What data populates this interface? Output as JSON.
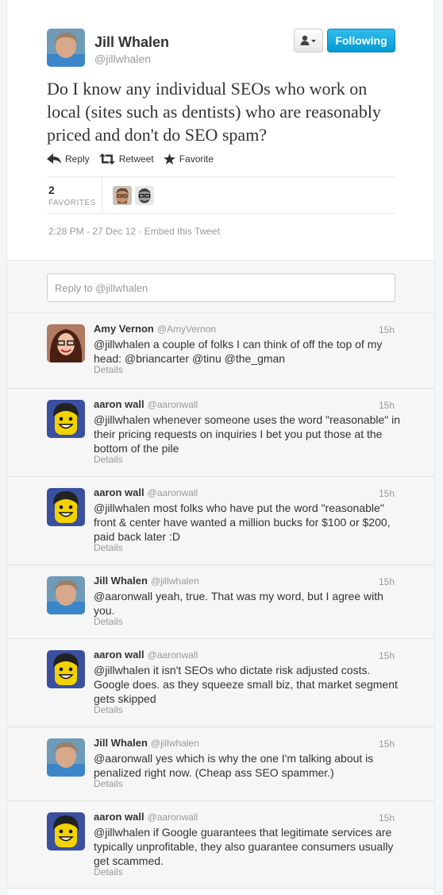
{
  "tweet": {
    "author_name": "Jill Whalen",
    "author_handle": "@jillwhalen",
    "text": "Do I know any individual SEOs who work on local (sites such as dentists) who are reasonably priced and don't do SEO spam?",
    "follow_label": "Following",
    "actions": {
      "reply": "Reply",
      "retweet": "Retweet",
      "favorite": "Favorite"
    },
    "favorites_count": "2",
    "favorites_label": "FAVORITES",
    "timestamp": "2:28 PM - 27 Dec 12",
    "embed_label": "Embed this Tweet"
  },
  "reply_box": {
    "placeholder": "Reply to @jillwhalen"
  },
  "replies": [
    {
      "name": "Amy Vernon",
      "handle": "@AmyVernon",
      "time": "15h",
      "text": "@jillwhalen a couple of folks I can think of off the top of my head: @briancarter @tinu @the_gman",
      "details": "Details",
      "avatar": "amy"
    },
    {
      "name": "aaron wall",
      "handle": "@aaronwall",
      "time": "15h",
      "text": "@jillwhalen whenever someone uses the word \"reasonable\" in their pricing requests on inquiries I bet you put those at the bottom of the pile",
      "details": "Details",
      "avatar": "lego"
    },
    {
      "name": "aaron wall",
      "handle": "@aaronwall",
      "time": "15h",
      "text": "@jillwhalen most folks who have put the word \"reasonable\" front & center have wanted a million bucks for $100 or $200, paid back later :D",
      "details": "Details",
      "avatar": "lego"
    },
    {
      "name": "Jill Whalen",
      "handle": "@jillwhalen",
      "time": "15h",
      "text": "@aaronwall yeah, true. That was my word, but I agree with you.",
      "details": "Details",
      "avatar": "jill"
    },
    {
      "name": "aaron wall",
      "handle": "@aaronwall",
      "time": "15h",
      "text": "@jillwhalen it isn't SEOs who dictate risk adjusted costs. Google does. as they squeeze small biz, that market segment gets skipped",
      "details": "Details",
      "avatar": "lego"
    },
    {
      "name": "Jill Whalen",
      "handle": "@jillwhalen",
      "time": "15h",
      "text": "@aaronwall yes which is why the one I'm talking about is penalized right now. (Cheap ass SEO spammer.)",
      "details": "Details",
      "avatar": "jill"
    },
    {
      "name": "aaron wall",
      "handle": "@aaronwall",
      "time": "15h",
      "text": "@jillwhalen if Google guarantees that legitimate services are typically unprofitable, they also guarantee consumers usually get scammed.",
      "details": "Details",
      "avatar": "lego"
    }
  ],
  "colors": {
    "follow_blue": "#1da1e2",
    "text": "#333333",
    "muted": "#999999"
  }
}
